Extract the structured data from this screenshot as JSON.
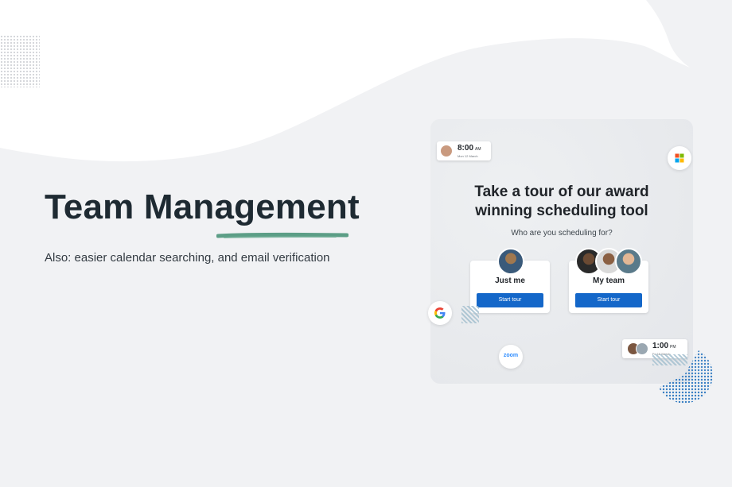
{
  "heading": {
    "title": "Team Management",
    "subtitle": "Also: easier calendar searching, and email verification",
    "accent_color": "#5c9e86"
  },
  "promo": {
    "title_line1": "Take a tour of our award",
    "title_line2": "winning scheduling tool",
    "question": "Who are you scheduling for?",
    "options": [
      {
        "label": "Just me",
        "button": "Start tour"
      },
      {
        "label": "My team",
        "button": "Start tour"
      }
    ],
    "button_color": "#1467c9",
    "chip_top": {
      "time": "8:00",
      "ampm": "AM",
      "date": "Mon 12 March"
    },
    "chip_bottom": {
      "time": "1:00",
      "ampm": "PM",
      "date": "Fri 16 March"
    },
    "icons": [
      "microsoft-icon",
      "google-icon",
      "zoom-icon"
    ],
    "zoom_label": "zoom"
  }
}
